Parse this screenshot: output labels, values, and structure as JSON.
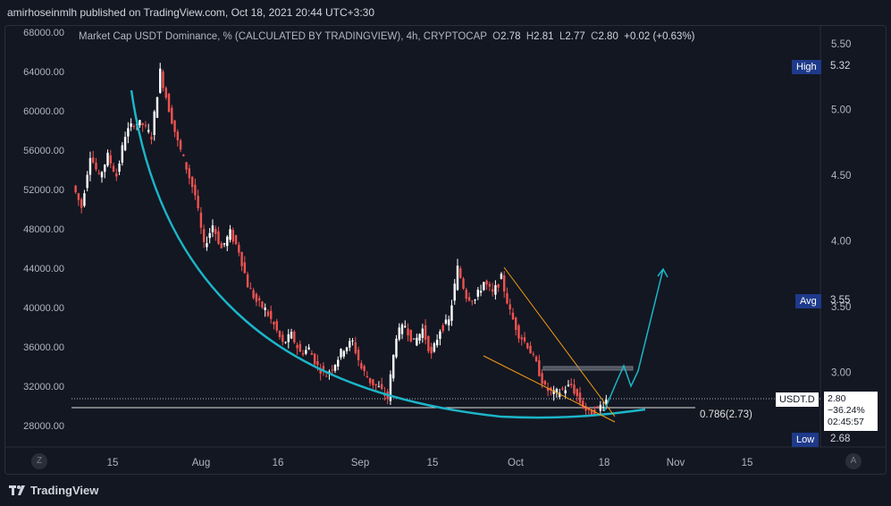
{
  "header": {
    "published": "amirhoseinmlh published on TradingView.com, Oct 18, 2021 20:44 UTC+3:30"
  },
  "legend": {
    "title": "Market Cap USDT Dominance, % (CALCULATED BY TRADINGVIEW), 4h, CRYPTOCAP",
    "o_label": "O",
    "o_value": "2.78",
    "h_label": "H",
    "h_value": "2.81",
    "l_label": "L",
    "l_value": "2.77",
    "c_label": "C",
    "c_value": "2.80",
    "change": "+0.02 (+0.63%)"
  },
  "chart_data": {
    "type": "line",
    "left_axis": {
      "ticks": [
        "68000.00",
        "64000.00",
        "60000.00",
        "56000.00",
        "52000.00",
        "48000.00",
        "44000.00",
        "40000.00",
        "36000.00",
        "32000.00",
        "28000.00"
      ],
      "values": [
        68000,
        64000,
        60000,
        56000,
        52000,
        48000,
        44000,
        40000,
        36000,
        32000,
        28000
      ]
    },
    "right_axis": {
      "ticks": [
        "5.50",
        "5.00",
        "4.50",
        "4.00",
        "3.50",
        "3.00"
      ],
      "values": [
        5.5,
        5.0,
        4.5,
        4.0,
        3.5,
        3.0
      ]
    },
    "x_ticks": [
      "15",
      "Aug",
      "16",
      "Sep",
      "15",
      "Oct",
      "18",
      "Nov",
      "15"
    ],
    "markers": {
      "high_label": "High",
      "high_value": "5.32",
      "avg_label": "Avg",
      "avg_value": "3.55",
      "low_label": "Low",
      "low_value": "2.68"
    },
    "fib_label": "0.786(2.73)",
    "current": {
      "label": "USDT.D",
      "value": "2.80",
      "change": "−36.24%",
      "countdown": "02:45:57"
    },
    "series": [
      {
        "values": [
          52400,
          50200,
          55600,
          53200,
          55400,
          53400,
          57600,
          58800,
          58600,
          57400,
          64000,
          60200,
          56800,
          54200,
          51400,
          46200,
          48400,
          46000,
          47600,
          45800,
          42300,
          40600,
          39800,
          38200,
          36300,
          37200,
          35400,
          35800,
          34000,
          33200,
          34400,
          35900,
          36500,
          33800,
          32500,
          31800,
          30800,
          37200,
          38200,
          36400,
          37800,
          35100,
          37800,
          38600,
          44000,
          41200,
          40800,
          42600,
          41400,
          43000,
          39500,
          37300,
          36200,
          34200,
          31800,
          31200,
          31600,
          32100,
          30400,
          29200,
          29700,
          30600
        ]
      }
    ]
  },
  "timezone_btn": "Z",
  "auto_btn": "A",
  "brand": "TradingView",
  "colors": {
    "bg": "#131722",
    "bull": "#ffffff",
    "bear": "#ef5350",
    "curve": "#1cb5c8",
    "wedge": "#f39c12",
    "projection": "#1cb5c8"
  }
}
